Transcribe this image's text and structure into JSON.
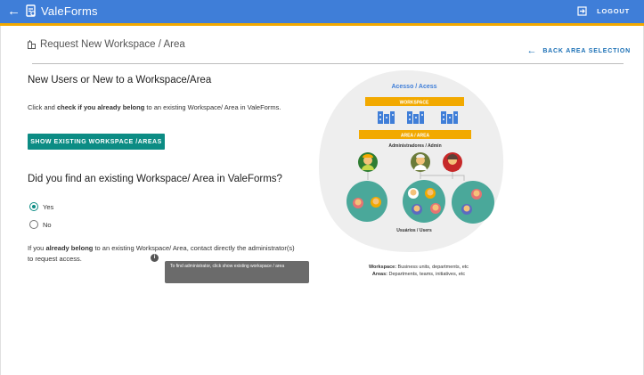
{
  "appbar": {
    "title": "ValeForms",
    "logout_label": "LOGOUT"
  },
  "header": {
    "title": "Request New Workspace / Area",
    "back_label": "BACK AREA SELECTION"
  },
  "section1": {
    "title": "New Users or New to a Workspace/Area",
    "text_prefix": "Click and ",
    "text_bold": "check if you already belong",
    "text_suffix": " to an existing Workspace/ Area in ValeForms.",
    "button_label": "SHOW EXISTING WORKSPACE /AREAS"
  },
  "section2": {
    "question": "Did you find an existing Workspace/ Area in ValeForms?",
    "options": [
      {
        "label": "Yes",
        "selected": true
      },
      {
        "label": "No",
        "selected": false
      }
    ],
    "text_prefix": "If you ",
    "text_bold": "already belong",
    "text_suffix": " to an existing Workspace/ Area, contact directly the administrator(s) to request access.",
    "tooltip": "To find administrator, click show existing workspace / area"
  },
  "illustration": {
    "title": "Acesso / Acess",
    "workspace_label": "WORKSPACE",
    "area_label": "AREA / AREA",
    "admin_label": "Administradores / Admin",
    "users_label": "Usuários / Users"
  },
  "caption": {
    "workspace_key": "Workspace:",
    "workspace_text": " Business units, departments, etc",
    "areas_key": "Areas:",
    "areas_text": " Departments, teams, initiatives, etc"
  },
  "colors": {
    "primary": "#3f7ed8",
    "accent_stripe": "#f2a900",
    "teal": "#0c8c84",
    "link": "#1a6fb5"
  },
  "icons": [
    "back-arrow-icon",
    "forms-icon",
    "logout-icon",
    "building-icon",
    "arrow-left-icon",
    "info-icon"
  ]
}
